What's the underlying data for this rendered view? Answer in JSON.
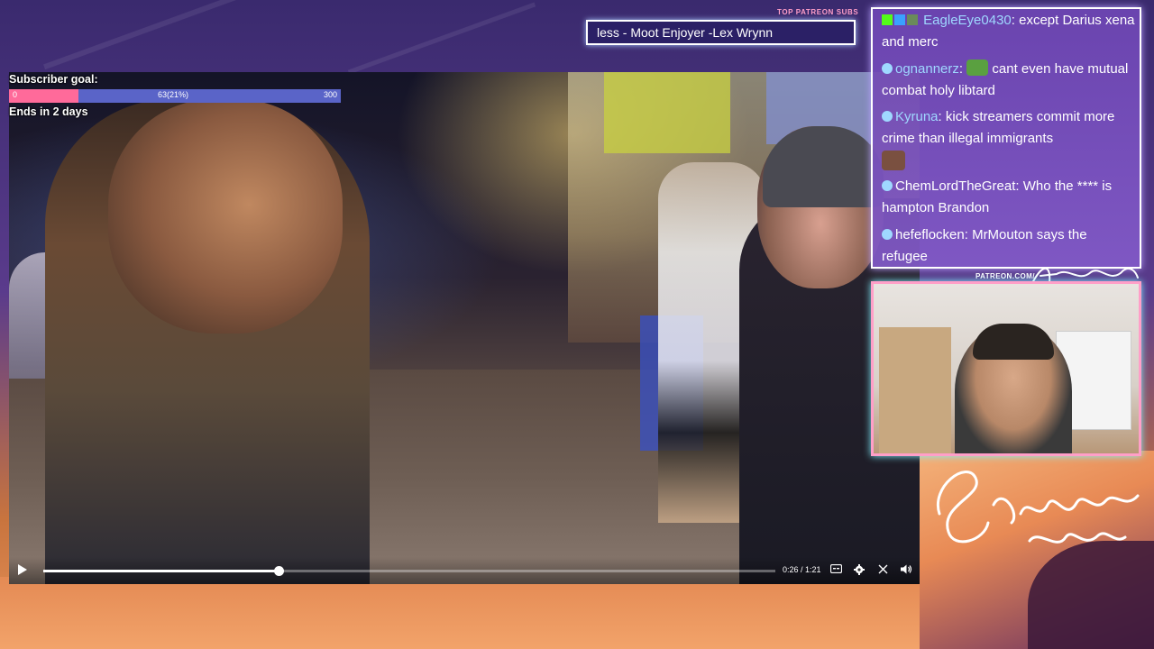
{
  "ticker": {
    "label": "TOP PATREON SUBS",
    "text": "less - Moot Enjoyer -Lex Wrynn"
  },
  "goal": {
    "title": "Subscriber goal:",
    "min": "0",
    "progress_text": "63(21%)",
    "max": "300",
    "progress_fraction": 0.21,
    "ends": "Ends in 2 days"
  },
  "player": {
    "time": "0:26 / 1:21",
    "progress_fraction": 0.321
  },
  "chat": {
    "messages": [
      {
        "user": "EagleEye0430",
        "text": ": except Darius xena and merc",
        "user_color": "#9fd8ff"
      },
      {
        "user": "ognannerz",
        "text": ": cant even have mutual combat holy libtard",
        "user_color": "#9fd8ff"
      },
      {
        "user": "Kyruna",
        "text": ": kick streamers commit more crime than illegal immigrants",
        "user_color": "#9fd8ff"
      },
      {
        "user": "ChemLordTheGreat",
        "text": ": Who the **** is hampton Brandon",
        "user_color": "#ffffff"
      },
      {
        "user": "hefeflocken",
        "text": ": MrMouton says the refugee",
        "user_color": "#ffffff"
      }
    ]
  },
  "cam": {
    "patreon_url": "PATREON.COM/"
  },
  "colors": {
    "accent_pink": "#ff6a9a",
    "goal_track": "#5a64c8",
    "chat_bg": "#7a50c0"
  }
}
